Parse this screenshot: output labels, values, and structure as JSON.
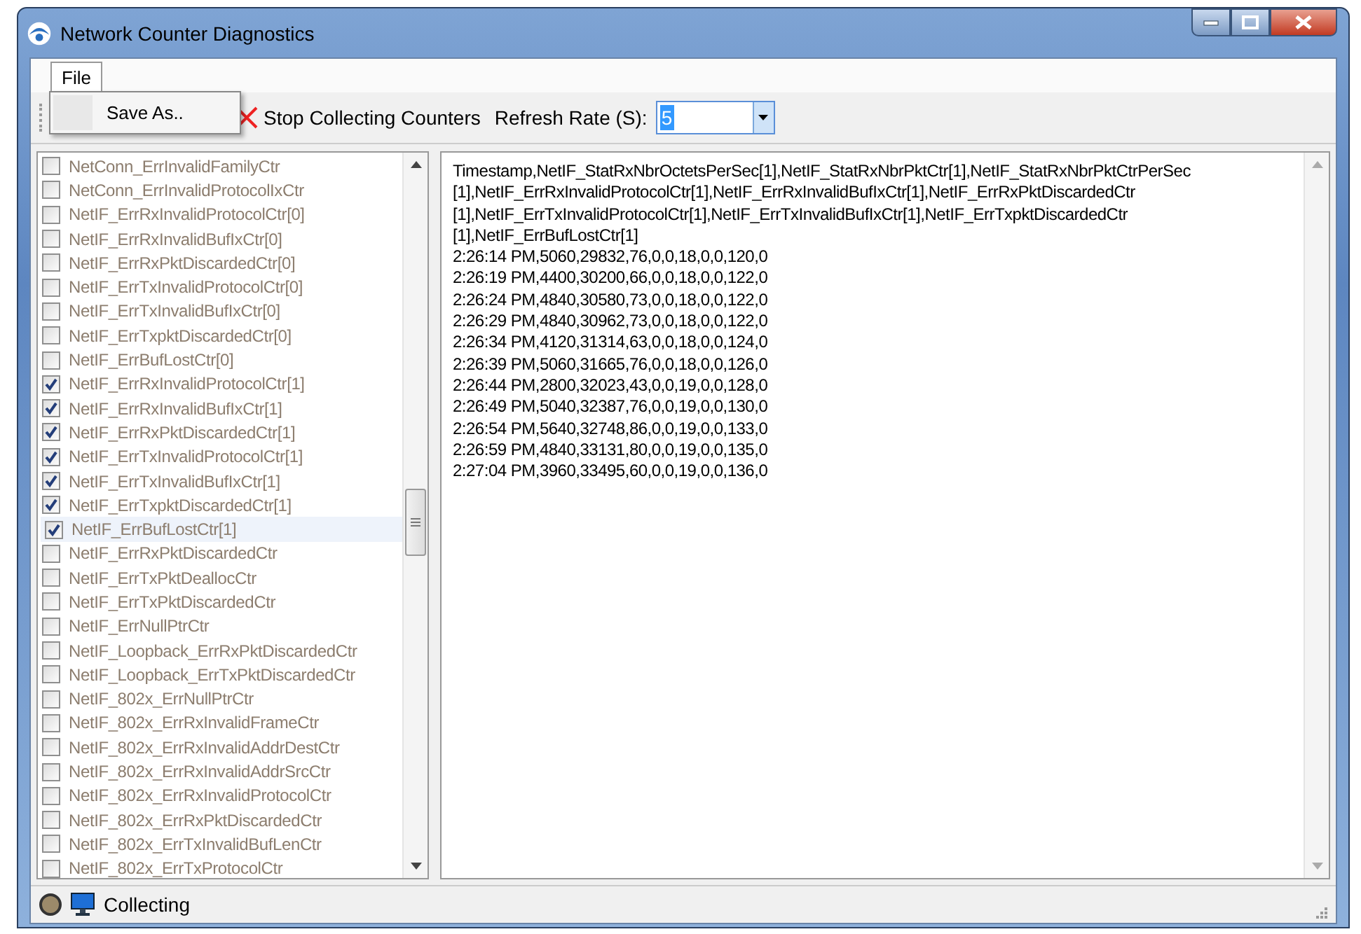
{
  "window": {
    "title": "Network Counter Diagnostics"
  },
  "menu": [
    {
      "label": "File",
      "expanded": true,
      "items": [
        {
          "label": "Save As.."
        }
      ]
    }
  ],
  "toolbar": {
    "stop_button": "Stop Collecting Counters",
    "refresh_label": "Refresh Rate (S):",
    "refresh_value": "5"
  },
  "counters": [
    {
      "label": "NetConn_ErrInvalidFamilyCtr",
      "checked": false,
      "selected": false
    },
    {
      "label": "NetConn_ErrInvalidProtocolIxCtr",
      "checked": false,
      "selected": false
    },
    {
      "label": "NetIF_ErrRxInvalidProtocolCtr[0]",
      "checked": false,
      "selected": false
    },
    {
      "label": "NetIF_ErrRxInvalidBufIxCtr[0]",
      "checked": false,
      "selected": false
    },
    {
      "label": "NetIF_ErrRxPktDiscardedCtr[0]",
      "checked": false,
      "selected": false
    },
    {
      "label": "NetIF_ErrTxInvalidProtocolCtr[0]",
      "checked": false,
      "selected": false
    },
    {
      "label": "NetIF_ErrTxInvalidBufIxCtr[0]",
      "checked": false,
      "selected": false
    },
    {
      "label": "NetIF_ErrTxpktDiscardedCtr[0]",
      "checked": false,
      "selected": false
    },
    {
      "label": "NetIF_ErrBufLostCtr[0]",
      "checked": false,
      "selected": false
    },
    {
      "label": "NetIF_ErrRxInvalidProtocolCtr[1]",
      "checked": true,
      "selected": false
    },
    {
      "label": "NetIF_ErrRxInvalidBufIxCtr[1]",
      "checked": true,
      "selected": false
    },
    {
      "label": "NetIF_ErrRxPktDiscardedCtr[1]",
      "checked": true,
      "selected": false
    },
    {
      "label": "NetIF_ErrTxInvalidProtocolCtr[1]",
      "checked": true,
      "selected": false
    },
    {
      "label": "NetIF_ErrTxInvalidBufIxCtr[1]",
      "checked": true,
      "selected": false
    },
    {
      "label": "NetIF_ErrTxpktDiscardedCtr[1]",
      "checked": true,
      "selected": false
    },
    {
      "label": "NetIF_ErrBufLostCtr[1]",
      "checked": true,
      "selected": true
    },
    {
      "label": "NetIF_ErrRxPktDiscardedCtr",
      "checked": false,
      "selected": false
    },
    {
      "label": "NetIF_ErrTxPktDeallocCtr",
      "checked": false,
      "selected": false
    },
    {
      "label": "NetIF_ErrTxPktDiscardedCtr",
      "checked": false,
      "selected": false
    },
    {
      "label": "NetIF_ErrNullPtrCtr",
      "checked": false,
      "selected": false
    },
    {
      "label": "NetIF_Loopback_ErrRxPktDiscardedCtr",
      "checked": false,
      "selected": false
    },
    {
      "label": "NetIF_Loopback_ErrTxPktDiscardedCtr",
      "checked": false,
      "selected": false
    },
    {
      "label": "NetIF_802x_ErrNullPtrCtr",
      "checked": false,
      "selected": false
    },
    {
      "label": "NetIF_802x_ErrRxInvalidFrameCtr",
      "checked": false,
      "selected": false
    },
    {
      "label": "NetIF_802x_ErrRxInvalidAddrDestCtr",
      "checked": false,
      "selected": false
    },
    {
      "label": "NetIF_802x_ErrRxInvalidAddrSrcCtr",
      "checked": false,
      "selected": false
    },
    {
      "label": "NetIF_802x_ErrRxInvalidProtocolCtr",
      "checked": false,
      "selected": false
    },
    {
      "label": "NetIF_802x_ErrRxPktDiscardedCtr",
      "checked": false,
      "selected": false
    },
    {
      "label": "NetIF_802x_ErrTxInvalidBufLenCtr",
      "checked": false,
      "selected": false
    },
    {
      "label": "NetIF_802x_ErrTxProtocolCtr",
      "checked": false,
      "selected": false
    }
  ],
  "log_lines": [
    "Timestamp,NetIF_StatRxNbrOctetsPerSec[1],NetIF_StatRxNbrPktCtr[1],NetIF_StatRxNbrPktCtrPerSec",
    "[1],NetIF_ErrRxInvalidProtocolCtr[1],NetIF_ErrRxInvalidBufIxCtr[1],NetIF_ErrRxPktDiscardedCtr",
    "[1],NetIF_ErrTxInvalidProtocolCtr[1],NetIF_ErrTxInvalidBufIxCtr[1],NetIF_ErrTxpktDiscardedCtr",
    "[1],NetIF_ErrBufLostCtr[1]",
    "2:26:14 PM,5060,29832,76,0,0,18,0,0,120,0",
    "2:26:19 PM,4400,30200,66,0,0,18,0,0,122,0",
    "2:26:24 PM,4840,30580,73,0,0,18,0,0,122,0",
    "2:26:29 PM,4840,30962,73,0,0,18,0,0,122,0",
    "2:26:34 PM,4120,31314,63,0,0,18,0,0,124,0",
    "2:26:39 PM,5060,31665,76,0,0,18,0,0,126,0",
    "2:26:44 PM,2800,32023,43,0,0,19,0,0,128,0",
    "2:26:49 PM,5040,32387,76,0,0,19,0,0,130,0",
    "2:26:54 PM,5640,32748,86,0,0,19,0,0,133,0",
    "2:26:59 PM,4840,33131,80,0,0,19,0,0,135,0",
    "2:27:04 PM,3960,33495,60,0,0,19,0,0,136,0"
  ],
  "status_bar": {
    "text": "Collecting"
  }
}
